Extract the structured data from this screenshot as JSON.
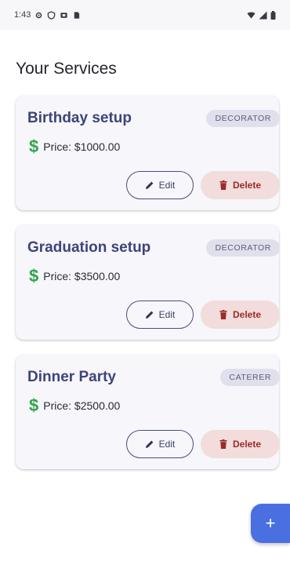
{
  "status_bar": {
    "time": "1:43",
    "left_icons": [
      "settings-icon",
      "shield-icon",
      "media-icon",
      "sim-icon"
    ],
    "right_icons": [
      "wifi-icon",
      "signal-icon",
      "battery-icon"
    ]
  },
  "page": {
    "title": "Your Services"
  },
  "services": [
    {
      "name": "Birthday setup",
      "category": "DECORATOR",
      "price": "Price: $1000.00",
      "edit_label": "Edit",
      "delete_label": "Delete"
    },
    {
      "name": "Graduation setup",
      "category": "DECORATOR",
      "price": "Price: $3500.00",
      "edit_label": "Edit",
      "delete_label": "Delete"
    },
    {
      "name": "Dinner Party",
      "category": "CATERER",
      "price": "Price: $2500.00",
      "edit_label": "Edit",
      "delete_label": "Delete"
    }
  ],
  "fab": {
    "label": "+"
  },
  "colors": {
    "title_accent": "#3d4579",
    "price_icon": "#2fa54a",
    "delete_bg": "#f2dcdc",
    "delete_text": "#9b2a2a",
    "fab_bg": "#4a6fe0"
  }
}
